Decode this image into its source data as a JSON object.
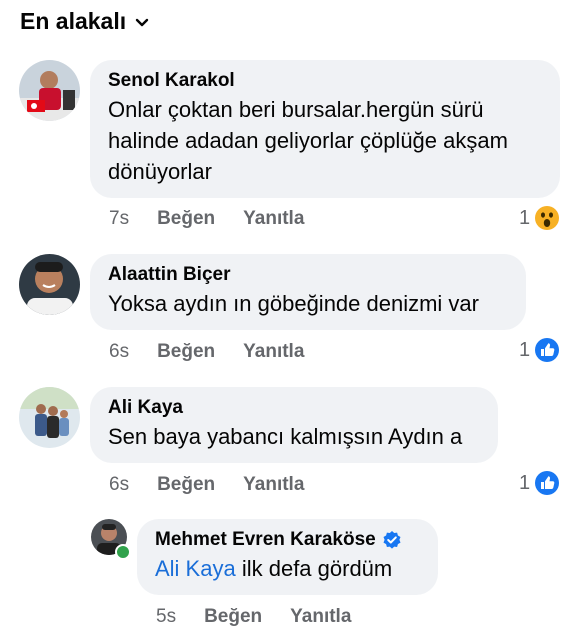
{
  "sort": {
    "label": "En alakalı"
  },
  "comments": [
    {
      "author": "Senol Karakol",
      "text_lines": [
        "Onlar çoktan beri bursalar.hergün sürü",
        "halinde adadan geliyorlar çöplüğe akşam",
        "dönüyorlar"
      ],
      "time": "7s",
      "like_label": "Beğen",
      "reply_label": "Yanıtla",
      "reaction_count": "1",
      "reaction": "wow-icon"
    },
    {
      "author": "Alaattin Biçer",
      "text_lines": [
        "Yoksa aydın ın göbeğinde denizmi var"
      ],
      "time": "6s",
      "like_label": "Beğen",
      "reply_label": "Yanıtla",
      "reaction_count": "1",
      "reaction": "like-icon"
    },
    {
      "author": "Ali Kaya",
      "text_lines": [
        "Sen baya yabancı kalmışsın Aydın a"
      ],
      "time": "6s",
      "like_label": "Beğen",
      "reply_label": "Yanıtla",
      "reaction_count": "1",
      "reaction": "like-icon"
    }
  ],
  "reply": {
    "author": "Mehmet Evren Karaköse",
    "verified": "verified-badge-icon",
    "mention": "Ali Kaya",
    "text": " ilk defa gördüm",
    "time": "5s",
    "like_label": "Beğen",
    "reply_label": "Yanıtla"
  },
  "colors": {
    "bubble": "#f0f2f5",
    "link": "#1a6ed8",
    "like_blue": "#1877f2",
    "meta": "#65676b"
  }
}
